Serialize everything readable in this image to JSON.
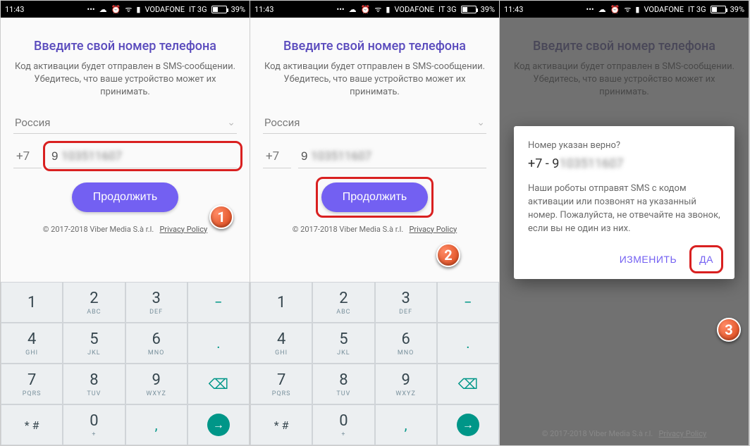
{
  "status": {
    "time": "11:43",
    "carrier": "VODAFONE",
    "network": "IT 3G",
    "battery": "39%"
  },
  "screen": {
    "title": "Введите свой номер телефона",
    "subtitle": "Код активации будет отправлен в SMS-сообщении. Убедитесь, что ваше устройство может их принимать.",
    "country": "Россия",
    "prefix": "+7",
    "number_first": "9",
    "continue": "Продолжить",
    "copyright": "© 2017-2018 Viber Media S.à r.l.",
    "privacy": "Privacy Policy"
  },
  "keypad": {
    "k1": "1",
    "k2": "2",
    "k2s": "ABC",
    "k3": "3",
    "k3s": "DEF",
    "k4": "4",
    "k4s": "GHI",
    "k5": "5",
    "k5s": "JKL",
    "k6": "6",
    "k6s": "MNO",
    "k7": "7",
    "k7s": "PQRS",
    "k8": "8",
    "k8s": "TUV",
    "k9": "9",
    "k9s": "WXYZ",
    "kstar": "* #",
    "k0": "0",
    "k0s": "+",
    "minus": "−",
    "dot": ".",
    "comma": ","
  },
  "dialog": {
    "question": "Номер указан верно?",
    "number_prefix": "+7 - ",
    "body": "Наши роботы отправят SMS с кодом активации или позвонят на указанный номер. Пожалуйста, не отвечайте на звонок, если вы не один из них.",
    "change": "ИЗМЕНИТЬ",
    "yes": "ДА"
  },
  "badges": {
    "b1": "1",
    "b2": "2",
    "b3": "3"
  }
}
